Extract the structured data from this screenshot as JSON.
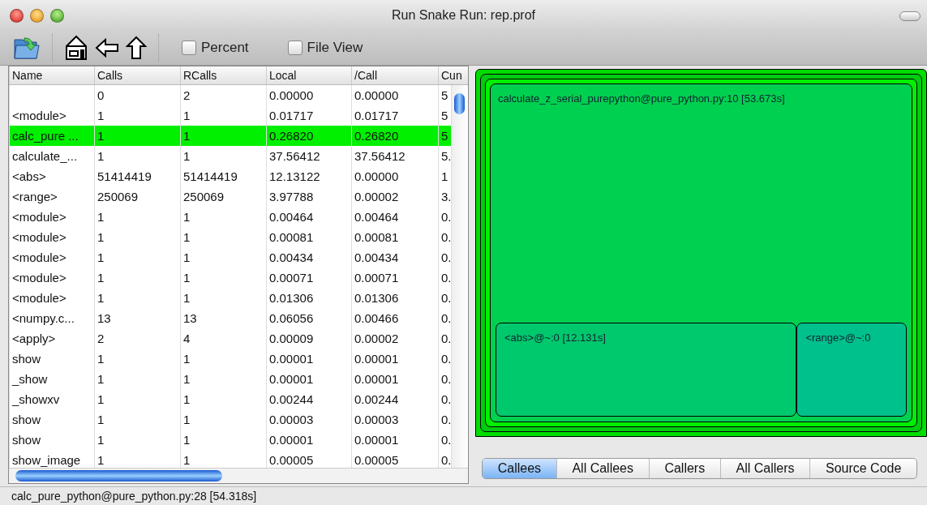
{
  "window": {
    "title": "Run Snake Run: rep.prof"
  },
  "toolbar": {
    "options": [
      {
        "label": "Percent",
        "checked": false
      },
      {
        "label": "File View",
        "checked": false
      }
    ]
  },
  "table": {
    "columns": [
      "Name",
      "Calls",
      "RCalls",
      "Local",
      "/Call",
      "Cun"
    ],
    "rows": [
      {
        "calls": "0",
        "rcalls": "2",
        "local": "0.00000",
        "per_call": "0.00000",
        "cum": "5",
        "selected": false
      },
      {
        "name": "<module>",
        "calls": "1",
        "rcalls": "1",
        "local": "0.01717",
        "per_call": "0.01717",
        "cum": "5",
        "selected": false
      },
      {
        "name": "calc_pure ...",
        "calls": "1",
        "rcalls": "1",
        "local": "0.26820",
        "per_call": "0.26820",
        "cum": "5",
        "selected": true
      },
      {
        "name": "calculate_...",
        "calls": "1",
        "rcalls": "1",
        "local": "37.56412",
        "per_call": "37.56412",
        "cum": "5.",
        "selected": false
      },
      {
        "name": "<abs>",
        "calls": "51414419",
        "rcalls": "51414419",
        "local": "12.13122",
        "per_call": "0.00000",
        "cum": "1",
        "selected": false
      },
      {
        "name": "<range>",
        "calls": "250069",
        "rcalls": "250069",
        "local": "3.97788",
        "per_call": "0.00002",
        "cum": "3.",
        "selected": false
      },
      {
        "name": "<module>",
        "calls": "1",
        "rcalls": "1",
        "local": "0.00464",
        "per_call": "0.00464",
        "cum": "0.",
        "selected": false
      },
      {
        "name": "<module>",
        "calls": "1",
        "rcalls": "1",
        "local": "0.00081",
        "per_call": "0.00081",
        "cum": "0.",
        "selected": false
      },
      {
        "name": "<module>",
        "calls": "1",
        "rcalls": "1",
        "local": "0.00434",
        "per_call": "0.00434",
        "cum": "0.",
        "selected": false
      },
      {
        "name": "<module>",
        "calls": "1",
        "rcalls": "1",
        "local": "0.00071",
        "per_call": "0.00071",
        "cum": "0.",
        "selected": false
      },
      {
        "name": "<module>",
        "calls": "1",
        "rcalls": "1",
        "local": "0.01306",
        "per_call": "0.01306",
        "cum": "0.",
        "selected": false
      },
      {
        "name": "<numpy.c...",
        "calls": "13",
        "rcalls": "13",
        "local": "0.06056",
        "per_call": "0.00466",
        "cum": "0.",
        "selected": false
      },
      {
        "name": "<apply>",
        "calls": "2",
        "rcalls": "4",
        "local": "0.00009",
        "per_call": "0.00002",
        "cum": "0.",
        "selected": false
      },
      {
        "name": "show",
        "calls": "1",
        "rcalls": "1",
        "local": "0.00001",
        "per_call": "0.00001",
        "cum": "0.",
        "selected": false
      },
      {
        "name": "_show",
        "calls": "1",
        "rcalls": "1",
        "local": "0.00001",
        "per_call": "0.00001",
        "cum": "0.",
        "selected": false
      },
      {
        "name": "_showxv",
        "calls": "1",
        "rcalls": "1",
        "local": "0.00244",
        "per_call": "0.00244",
        "cum": "0.",
        "selected": false
      },
      {
        "name": "show",
        "calls": "1",
        "rcalls": "1",
        "local": "0.00003",
        "per_call": "0.00003",
        "cum": "0.",
        "selected": false
      },
      {
        "name": "show",
        "calls": "1",
        "rcalls": "1",
        "local": "0.00001",
        "per_call": "0.00001",
        "cum": "0.",
        "selected": false
      },
      {
        "name": "show_image",
        "calls": "1",
        "rcalls": "1",
        "local": "0.00005",
        "per_call": "0.00005",
        "cum": "0.",
        "selected": false
      }
    ]
  },
  "treemap": {
    "label": "calculate_z_serial_purepython@pure_python.py:10 [53.673s]",
    "children": [
      {
        "label": "<abs>@~:0 [12.131s]",
        "color": "#00c86c"
      },
      {
        "label": "<range>@~:0",
        "color": "#00c08c"
      }
    ]
  },
  "tabs": [
    {
      "label": "Callees",
      "selected": true
    },
    {
      "label": "All Callees",
      "selected": false
    },
    {
      "label": "Callers",
      "selected": false
    },
    {
      "label": "All Callers",
      "selected": false
    },
    {
      "label": "Source Code",
      "selected": false
    }
  ],
  "status_bar": "calc_pure_python@pure_python.py:28 [54.318s]"
}
